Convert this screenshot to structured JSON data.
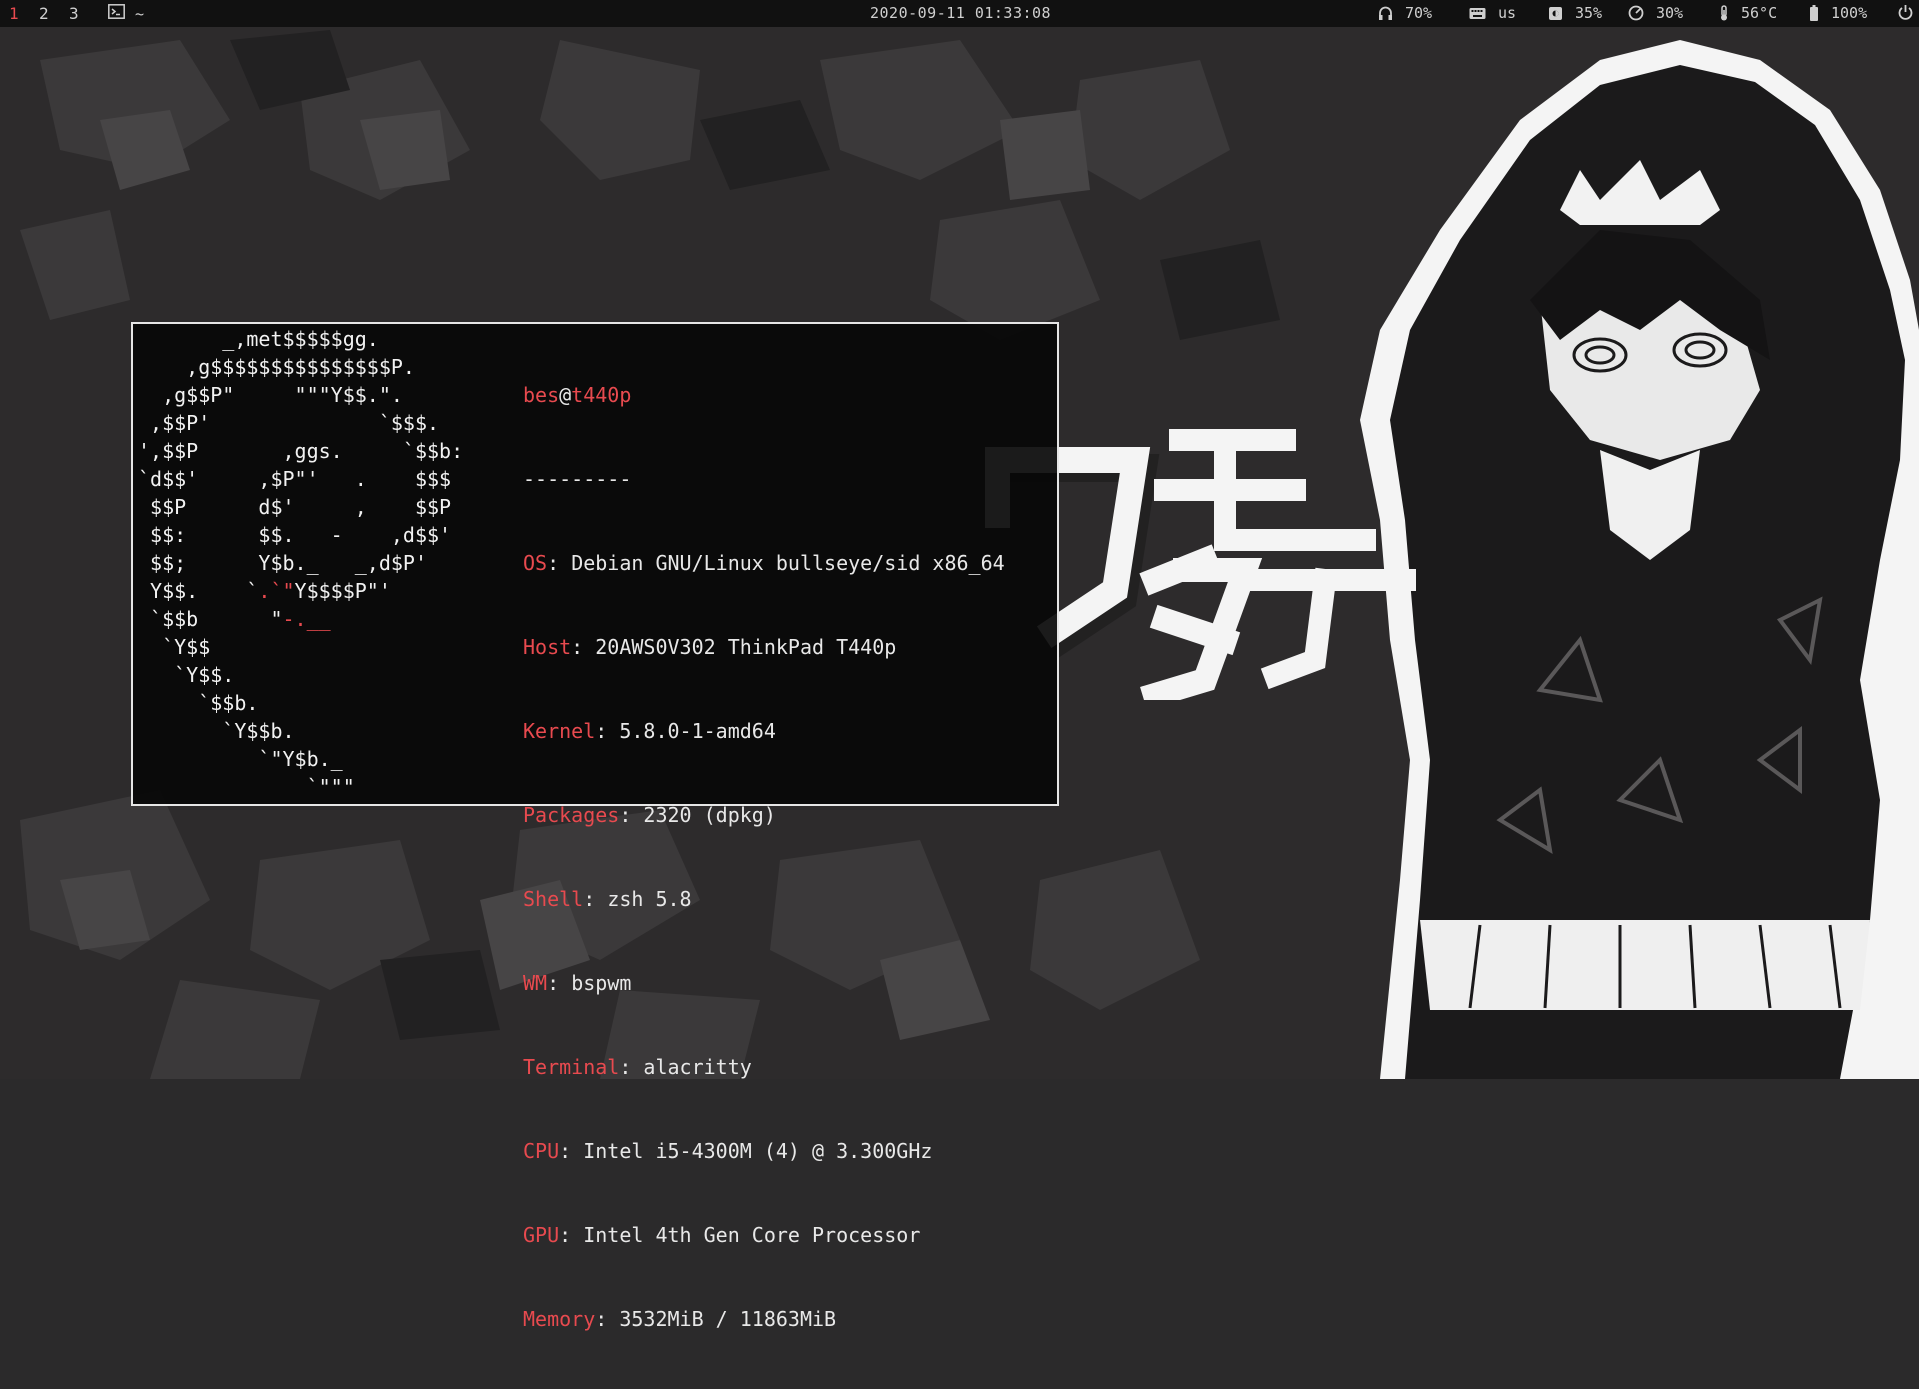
{
  "topbar": {
    "workspaces": [
      "1",
      "2",
      "3"
    ],
    "active_workspace": "1",
    "window": {
      "icon": "terminal-icon",
      "title": "~"
    },
    "clock": "2020-09-11 01:33:08",
    "volume": {
      "icon": "headphones-icon",
      "value": "70%"
    },
    "keyboard": {
      "icon": "keyboard-icon",
      "value": "us"
    },
    "brightness": {
      "icon": "brightness-icon",
      "value": "35%"
    },
    "cpu": {
      "icon": "gauge-icon",
      "value": "30%"
    },
    "temperature": {
      "icon": "thermometer-icon",
      "value": "56°C"
    },
    "battery": {
      "icon": "battery-icon",
      "value": "100%"
    },
    "power": {
      "icon": "power-icon"
    }
  },
  "terminal": {
    "ascii_logo": [
      "       _,met$$$$$gg.",
      "    ,g$$$$$$$$$$$$$$$P.",
      "  ,g$$P\"     \"\"\"Y$$.\".",
      " ,$$P'              `$$$.",
      "',$$P       ,ggs.     `$$b:",
      "`d$$'     ,$P\"'   .    $$$",
      " $$P      d$'     ,    $$P",
      " $$:      $$.   -    ,d$$'",
      " $$;      Y$b._   _,d$P'",
      " Y$$.    `.`\"Y$$$$P\"'",
      " `$$b      \"-.__",
      "  `Y$$",
      "   `Y$$.",
      "     `$$b.",
      "       `Y$$b.",
      "          `\"Y$b._",
      "              `\"\"\""
    ],
    "user": "bes",
    "at": "@",
    "host": "t440p",
    "separator": "---------",
    "info": [
      {
        "key": "OS",
        "value": "Debian GNU/Linux bullseye/sid x86_64"
      },
      {
        "key": "Host",
        "value": "20AWS0V302 ThinkPad T440p"
      },
      {
        "key": "Kernel",
        "value": "5.8.0-1-amd64"
      },
      {
        "key": "Packages",
        "value": "2320 (dpkg)"
      },
      {
        "key": "Shell",
        "value": "zsh 5.8"
      },
      {
        "key": "WM",
        "value": "bspwm"
      },
      {
        "key": "Terminal",
        "value": "alacritty"
      },
      {
        "key": "CPU",
        "value": "Intel i5-4300M (4) @ 3.300GHz"
      },
      {
        "key": "GPU",
        "value": "Intel 4th Gen Core Processor"
      },
      {
        "key": "Memory",
        "value": "3532MiB / 11863MiB"
      }
    ]
  },
  "wallpaper": {
    "title": "ワタモテ",
    "accent": "#e84a4f"
  }
}
